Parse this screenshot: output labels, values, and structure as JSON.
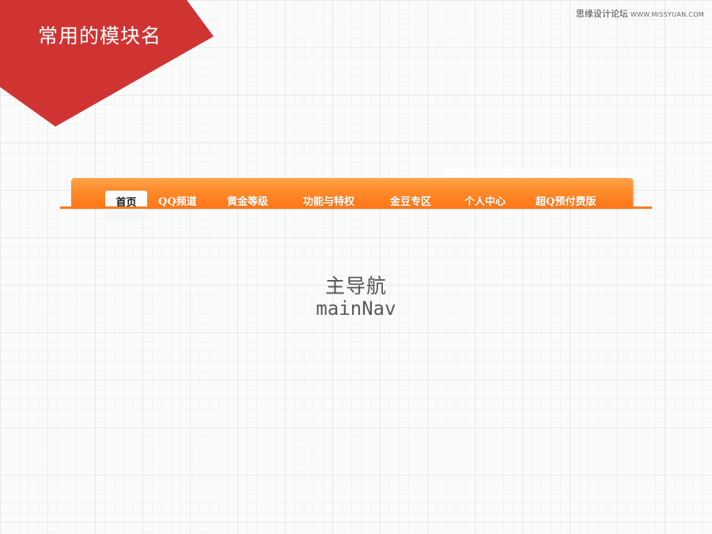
{
  "banner": {
    "title": "常用的模块名",
    "color": "#d03432"
  },
  "watermark": {
    "text": "思缘设计论坛",
    "url": "WWW.MISSYUAN.COM"
  },
  "nav": {
    "accent": "#ff8a2a",
    "items": [
      {
        "label": "首页",
        "active": true
      },
      {
        "label": "QQ频道",
        "active": false
      },
      {
        "label": "黄金等级",
        "active": false
      },
      {
        "label": "功能与特权",
        "active": false
      },
      {
        "label": "金豆专区",
        "active": false
      },
      {
        "label": "个人中心",
        "active": false
      },
      {
        "label": "超Q预付费版",
        "active": false
      }
    ]
  },
  "caption": {
    "chinese": "主导航",
    "english": "mainNav"
  }
}
